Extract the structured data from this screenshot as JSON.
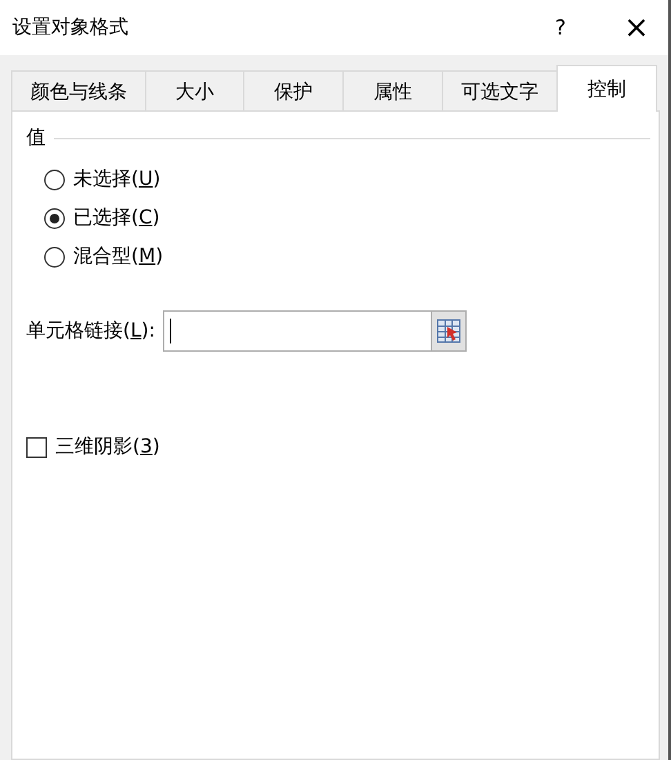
{
  "window": {
    "title": "设置对象格式",
    "help": "?",
    "close": "×"
  },
  "tabs": [
    {
      "label": "颜色与线条",
      "selected": false
    },
    {
      "label": "大小",
      "selected": false
    },
    {
      "label": "保护",
      "selected": false
    },
    {
      "label": "属性",
      "selected": false
    },
    {
      "label": "可选文字",
      "selected": false
    },
    {
      "label": "控制",
      "selected": true
    }
  ],
  "value_group": {
    "title": "值",
    "options": [
      {
        "before": "未选择(",
        "key": "U",
        "after": ")",
        "selected": false
      },
      {
        "before": "已选择(",
        "key": "C",
        "after": ")",
        "selected": true
      },
      {
        "before": "混合型(",
        "key": "M",
        "after": ")",
        "selected": false
      }
    ]
  },
  "cell_link": {
    "before": "单元格链接(",
    "key": "L",
    "after": "):"
  },
  "shadow_3d": {
    "before": "三维阴影(",
    "key": "3",
    "after": ")",
    "checked": false
  }
}
